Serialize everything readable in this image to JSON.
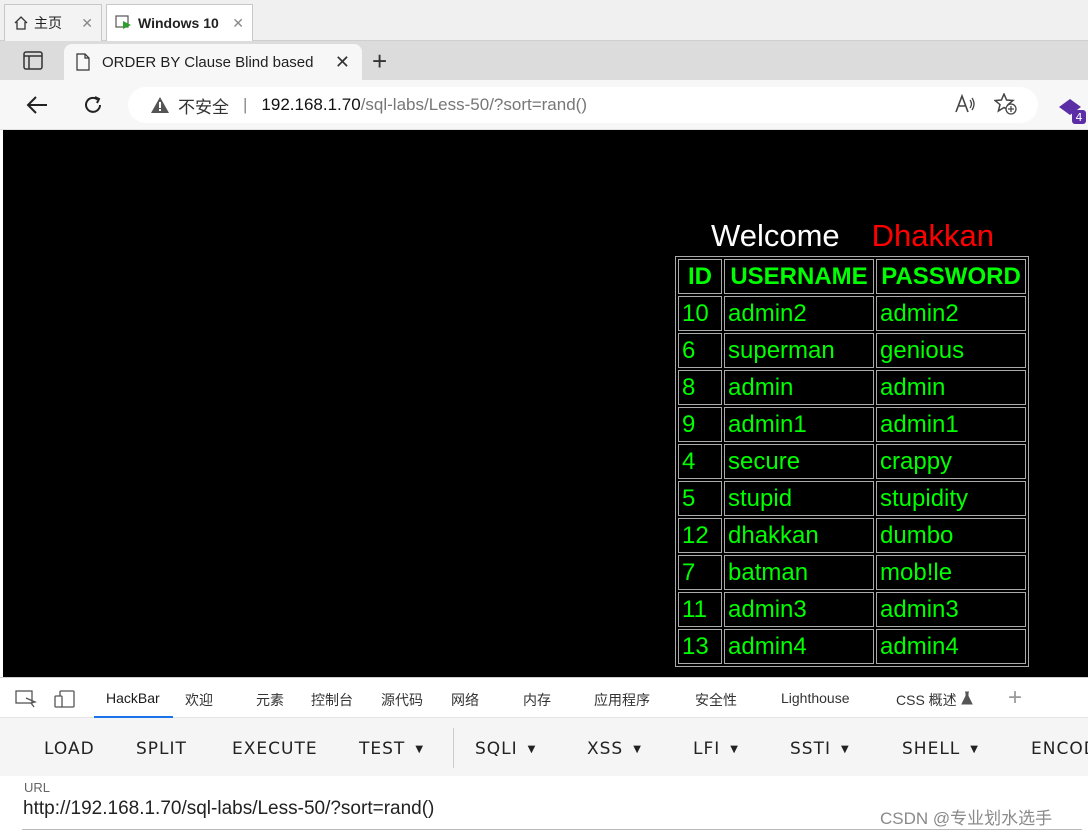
{
  "vm_tabs": [
    {
      "label": "主页",
      "active": false
    },
    {
      "label": "Windows 10",
      "active": true
    }
  ],
  "browser": {
    "tab_title": "ORDER BY Clause Blind based",
    "security_warning": "不安全",
    "url_host": "192.168.1.70",
    "url_path": "/sql-labs/Less-50/?sort=rand()",
    "extension_badge": "4"
  },
  "page": {
    "welcome": "Welcome",
    "user": "Dhakkan",
    "colors": {
      "background": "#000000",
      "text": "#00ff00",
      "user": "#ff0000"
    },
    "headers": [
      "ID",
      "USERNAME",
      "PASSWORD"
    ],
    "rows": [
      [
        "10",
        "admin2",
        "admin2"
      ],
      [
        "6",
        "superman",
        "genious"
      ],
      [
        "8",
        "admin",
        "admin"
      ],
      [
        "9",
        "admin1",
        "admin1"
      ],
      [
        "4",
        "secure",
        "crappy"
      ],
      [
        "5",
        "stupid",
        "stupidity"
      ],
      [
        "12",
        "dhakkan",
        "dumbo"
      ],
      [
        "7",
        "batman",
        "mob!le"
      ],
      [
        "11",
        "admin3",
        "admin3"
      ],
      [
        "13",
        "admin4",
        "admin4"
      ]
    ]
  },
  "devtools": {
    "tabs": [
      "HackBar",
      "欢迎",
      "元素",
      "控制台",
      "源代码",
      "网络",
      "内存",
      "应用程序",
      "安全性",
      "Lighthouse",
      "CSS 概述"
    ],
    "active_tab": "HackBar"
  },
  "hackbar": {
    "buttons": [
      "LOAD",
      "SPLIT",
      "EXECUTE"
    ],
    "dropdowns": [
      "TEST",
      "SQLI",
      "XSS",
      "LFI",
      "SSTI",
      "SHELL"
    ],
    "cut_off": "ENCOD",
    "url_label": "URL",
    "url_value": "http://192.168.1.70/sql-labs/Less-50/?sort=rand()"
  },
  "watermark": "CSDN @专业划水选手"
}
